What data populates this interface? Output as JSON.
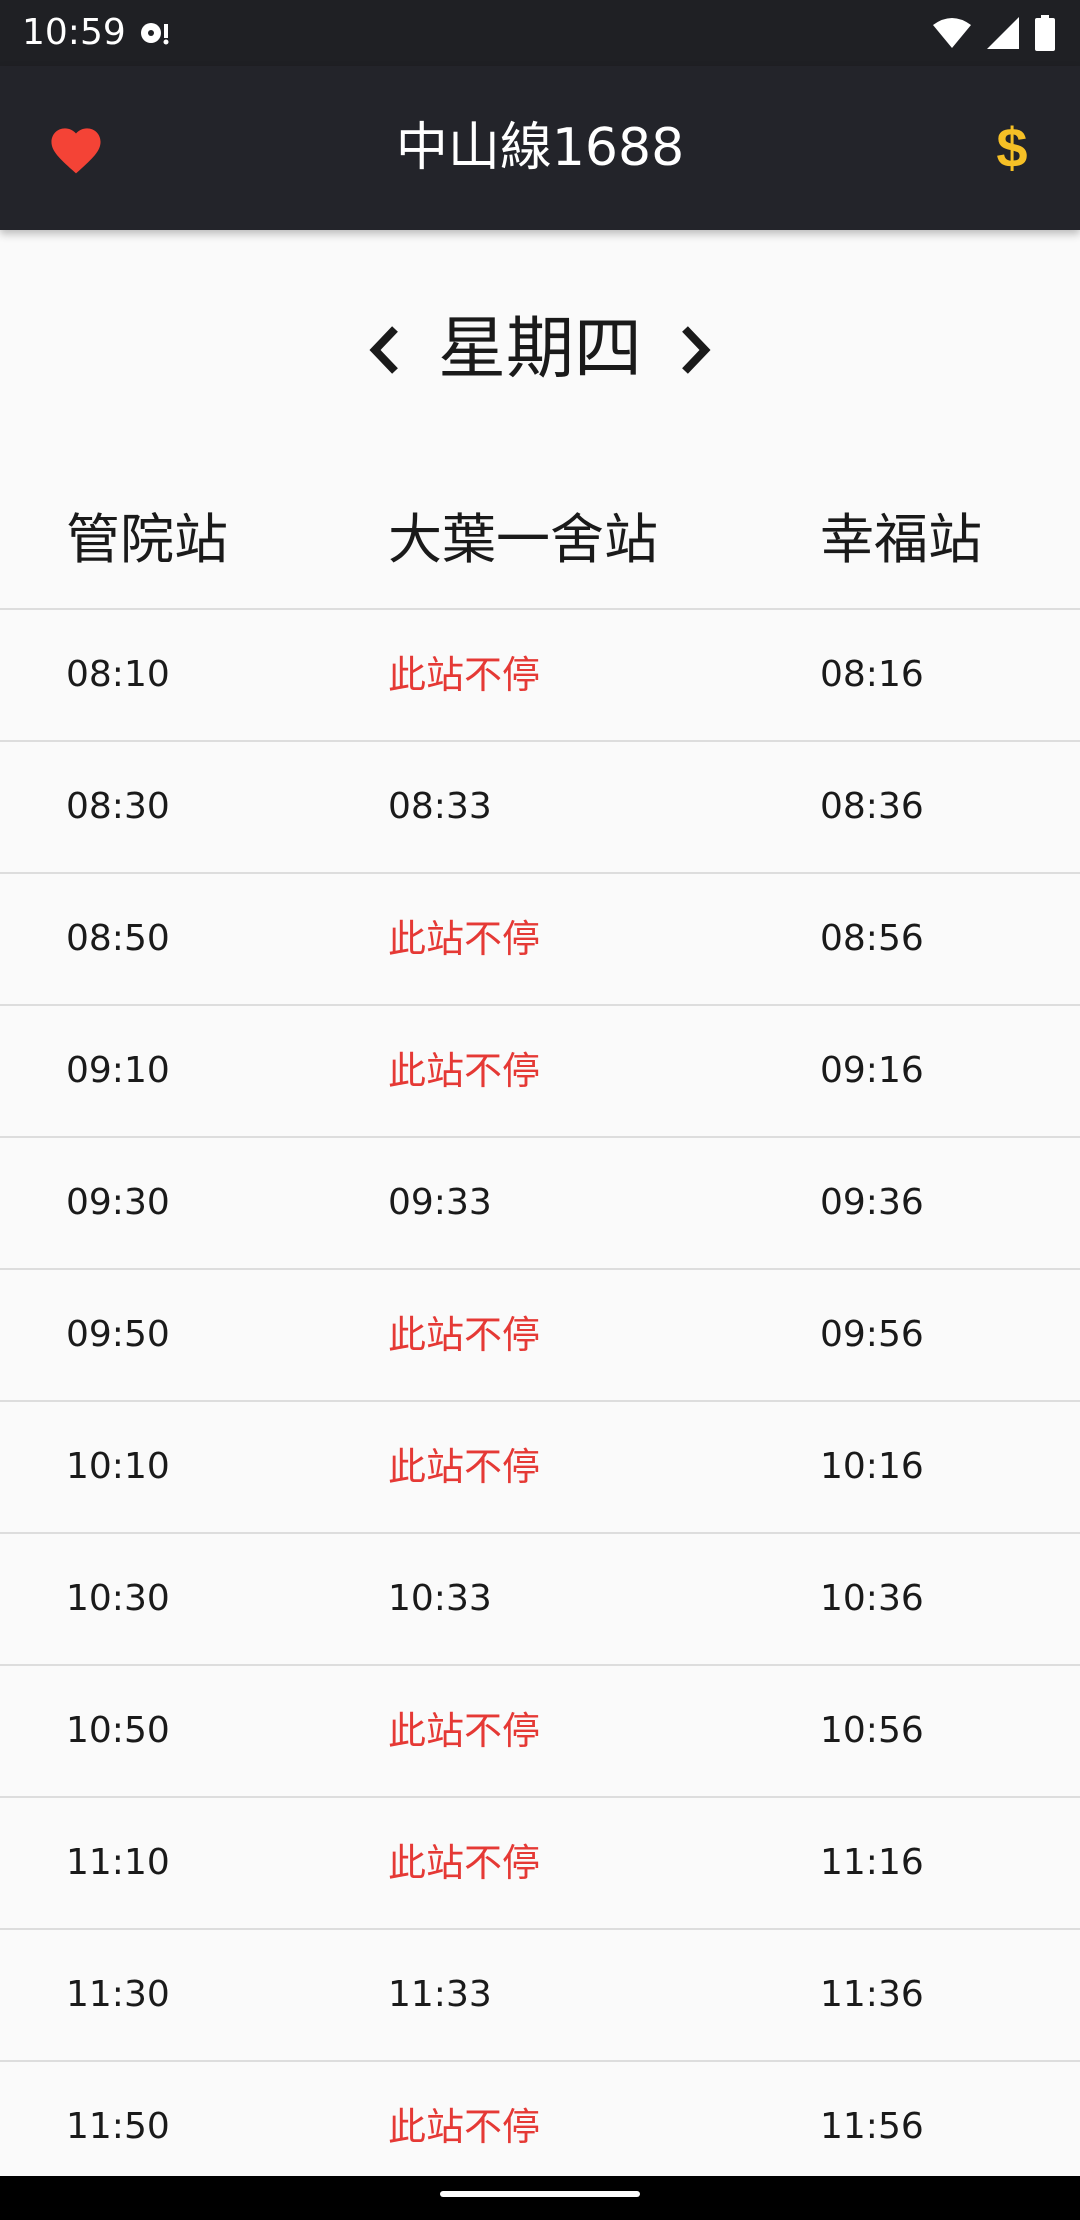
{
  "status_bar": {
    "time": "10:59",
    "icons": [
      "media-notification-icon",
      "wifi-icon",
      "cell-signal-icon",
      "battery-icon"
    ]
  },
  "app_bar": {
    "title": "中山線1688",
    "left_icon": "heart-icon",
    "right_icon": "dollar-icon",
    "left_icon_color": "#f44336",
    "right_icon_color": "#f6c026",
    "background": "#23242a"
  },
  "day_selector": {
    "label": "星期四",
    "prev_icon": "chevron-left-icon",
    "next_icon": "chevron-right-icon"
  },
  "stations": [
    "管院站",
    "大葉一舍站",
    "幸福站"
  ],
  "no_stop_color": "#e53935",
  "timetable": [
    [
      "08:10",
      "此站不停",
      "08:16"
    ],
    [
      "08:30",
      "08:33",
      "08:36"
    ],
    [
      "08:50",
      "此站不停",
      "08:56"
    ],
    [
      "09:10",
      "此站不停",
      "09:16"
    ],
    [
      "09:30",
      "09:33",
      "09:36"
    ],
    [
      "09:50",
      "此站不停",
      "09:56"
    ],
    [
      "10:10",
      "此站不停",
      "10:16"
    ],
    [
      "10:30",
      "10:33",
      "10:36"
    ],
    [
      "10:50",
      "此站不停",
      "10:56"
    ],
    [
      "11:10",
      "此站不停",
      "11:16"
    ],
    [
      "11:30",
      "11:33",
      "11:36"
    ],
    [
      "11:50",
      "此站不停",
      "11:56"
    ]
  ]
}
